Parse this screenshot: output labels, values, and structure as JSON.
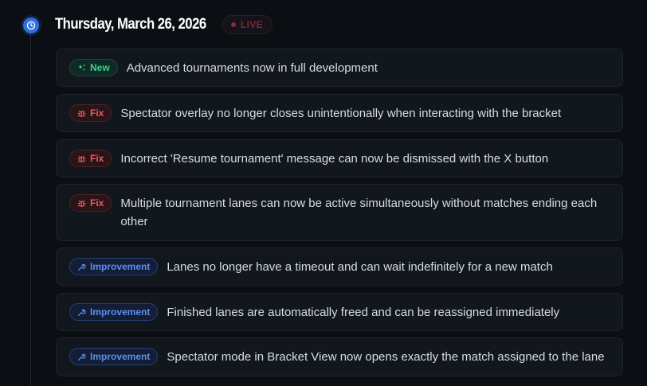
{
  "date": {
    "title": "Thursday, March 26, 2026",
    "live_label": "LIVE"
  },
  "colors": {
    "accent": "#2f6fe0",
    "new": "#3bd29a",
    "fix": "#ee5a5f",
    "improvement": "#5b8ff2"
  },
  "entries": [
    {
      "badge": "New",
      "badge_icon": "sparkle-icon",
      "text": "Advanced tournaments now in full development"
    },
    {
      "badge": "Fix",
      "badge_icon": "bug-icon",
      "text": "Spectator overlay no longer closes unintentionally when interacting with the bracket"
    },
    {
      "badge": "Fix",
      "badge_icon": "bug-icon",
      "text": "Incorrect 'Resume tournament' message can now be dismissed with the X button"
    },
    {
      "badge": "Fix",
      "badge_icon": "bug-icon",
      "text": "Multiple tournament lanes can now be active simultaneously without matches ending each other"
    },
    {
      "badge": "Improvement",
      "badge_icon": "wrench-icon",
      "text": "Lanes no longer have a timeout and can wait indefinitely for a new match"
    },
    {
      "badge": "Improvement",
      "badge_icon": "wrench-icon",
      "text": "Finished lanes are automatically freed and can be reassigned immediately"
    },
    {
      "badge": "Improvement",
      "badge_icon": "wrench-icon",
      "text": "Spectator mode in Bracket View now opens exactly the match assigned to the lane"
    }
  ]
}
